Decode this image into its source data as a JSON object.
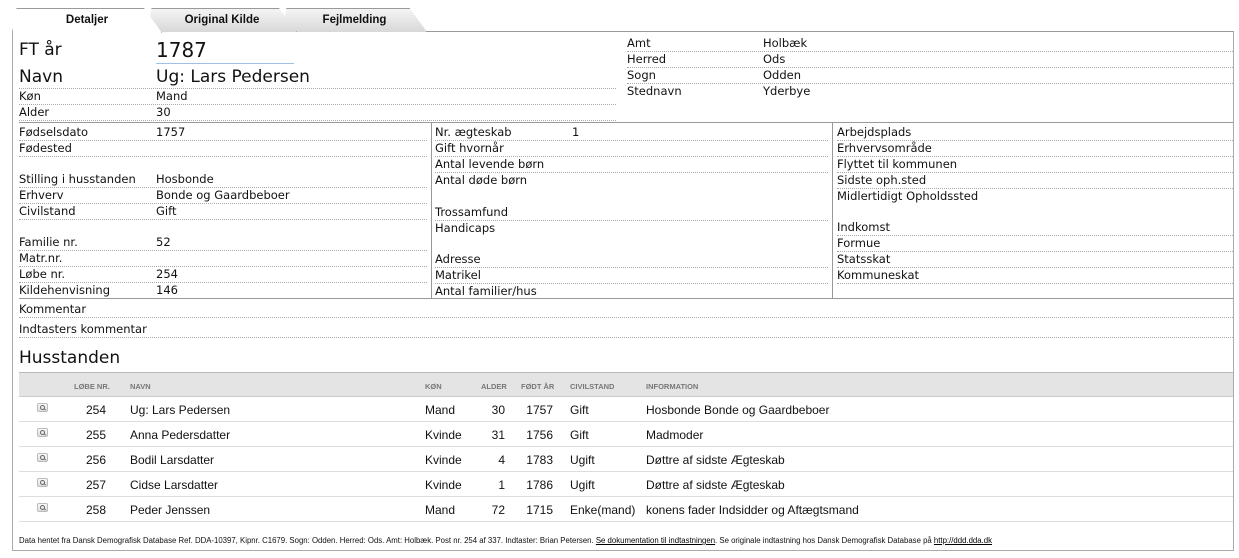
{
  "tabs": [
    "Detaljer",
    "Original Kilde",
    "Fejlmelding"
  ],
  "header": {
    "ft_label": "FT år",
    "ft_value": "1787",
    "navn_label": "Navn",
    "navn_value": "Ug: Lars Pedersen",
    "kon_label": "Køn",
    "kon_value": "Mand",
    "alder_label": "Alder",
    "alder_value": "30"
  },
  "location": {
    "amt_label": "Amt",
    "amt_value": "Holbæk",
    "herred_label": "Herred",
    "herred_value": "Ods",
    "sogn_label": "Sogn",
    "sogn_value": "Odden",
    "stednavn_label": "Stednavn",
    "stednavn_value": "Yderbye"
  },
  "col1": {
    "fodselsdato_label": "Fødselsdato",
    "fodselsdato_value": "1757",
    "fodested_label": "Fødested",
    "stilling_label": "Stilling i husstanden",
    "stilling_value": "Hosbonde",
    "erhverv_label": "Erhverv",
    "erhverv_value": "Bonde og Gaardbeboer",
    "civilstand_label": "Civilstand",
    "civilstand_value": "Gift",
    "familie_label": "Familie nr.",
    "familie_value": "52",
    "matr_label": "Matr.nr.",
    "lobe_label": "Løbe nr.",
    "lobe_value": "254",
    "kilde_label": "Kildehenvisning",
    "kilde_value": "146"
  },
  "col2": {
    "aegteskab_label": "Nr. ægteskab",
    "aegteskab_value": "1",
    "gift_label": "Gift hvornår",
    "levende_label": "Antal levende børn",
    "dode_label": "Antal døde børn",
    "tro_label": "Trossamfund",
    "handicaps_label": "Handicaps",
    "adresse_label": "Adresse",
    "matrikel_label": "Matrikel",
    "familier_label": "Antal familier/hus"
  },
  "col3": {
    "arbejdsplads_label": "Arbejdsplads",
    "erhvervsomrade_label": "Erhvervsområde",
    "flyttet_label": "Flyttet til kommunen",
    "sidste_label": "Sidste oph.sted",
    "midl_label": "Midlertidigt Opholdssted",
    "indkomst_label": "Indkomst",
    "formue_label": "Formue",
    "statsskat_label": "Statsskat",
    "kommuneskat_label": "Kommuneskat"
  },
  "comments": {
    "kommentar_label": "Kommentar",
    "indtaster_label": "Indtasters kommentar"
  },
  "husstanden": {
    "title": "Husstanden",
    "headers": [
      "LØBE NR.",
      "NAVN",
      "KØN",
      "ALDER",
      "FØDT ÅR",
      "CIVILSTAND",
      "INFORMATION"
    ],
    "rows": [
      [
        "254",
        "Ug: Lars Pedersen",
        "Mand",
        "30",
        "1757",
        "Gift",
        "Hosbonde Bonde og Gaardbeboer"
      ],
      [
        "255",
        "Anna Pedersdatter",
        "Kvinde",
        "31",
        "1756",
        "Gift",
        "Madmoder"
      ],
      [
        "256",
        "Bodil Larsdatter",
        "Kvinde",
        "4",
        "1783",
        "Ugift",
        "Døttre af sidste Ægteskab"
      ],
      [
        "257",
        "Cidse Larsdatter",
        "Kvinde",
        "1",
        "1786",
        "Ugift",
        "Døttre af sidste Ægteskab"
      ],
      [
        "258",
        "Peder Jenssen",
        "Mand",
        "72",
        "1715",
        "Enke(mand)",
        "konens fader Indsidder og Aftægtsmand"
      ]
    ]
  },
  "footer": {
    "text1": "Data hentet fra Dansk Demografisk Database Ref. DDA-10397, Kipnr. C1679. Sogn: Odden. Herred: Ods. Amt: Holbæk. Post nr. 254 af 337. Indtaster: Brian Petersen. ",
    "link1": "Se dokumentation til indtastningen",
    "text2": ". Se originale indtastning hos Dansk Demografisk Database på ",
    "link2": "http://ddd.dda.dk"
  }
}
